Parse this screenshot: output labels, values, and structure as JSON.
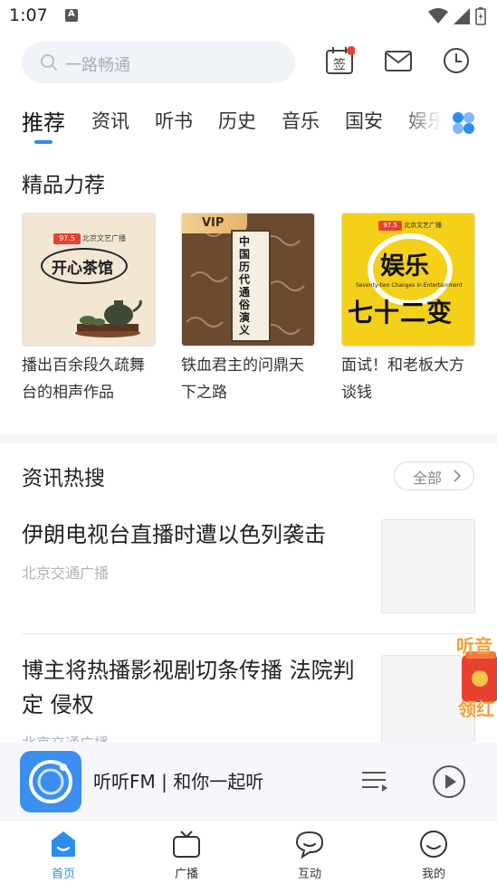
{
  "status_bar": {
    "time": "1:07"
  },
  "search": {
    "placeholder": "一路畅通"
  },
  "header_icons": [
    "sign-in-icon",
    "mail-icon",
    "history-clock-icon"
  ],
  "tabs": [
    {
      "label": "推荐",
      "active": true
    },
    {
      "label": "资讯"
    },
    {
      "label": "听书"
    },
    {
      "label": "历史"
    },
    {
      "label": "音乐"
    },
    {
      "label": "国安"
    },
    {
      "label": "娱乐"
    }
  ],
  "featured": {
    "title": "精品力荐",
    "items": [
      {
        "title": "播出百余段久疏舞台的相声作品",
        "cover_text": "开心茶馆",
        "cover_badge": "97.5",
        "cover_brand": "北京文艺广播"
      },
      {
        "title": "铁血君主的问鼎天下之路",
        "cover_text": "中国历代通俗演义",
        "cover_badge": "VIP"
      },
      {
        "title": "面试！和老板大方谈钱",
        "cover_text_1": "娱乐",
        "cover_text_2": "七十二变",
        "cover_subtitle": "Seventy-two Changes in Entertainment",
        "cover_badge": "97.5",
        "cover_brand": "北京文艺广播"
      }
    ]
  },
  "hot_news": {
    "title": "资讯热搜",
    "all_label": "全部",
    "items": [
      {
        "title": "伊朗电视台直播时遭以色列袭击",
        "source": "北京交通广播"
      },
      {
        "title": "博主将热播影视剧切条传播 法院判定 侵权",
        "source": "北京交通广播"
      }
    ]
  },
  "float_badge": {
    "text_1": "听音",
    "text_2": "领红"
  },
  "player": {
    "title": "听听FM | 和你一起听"
  },
  "bottom_nav": [
    {
      "label": "首页",
      "active": true
    },
    {
      "label": "广播"
    },
    {
      "label": "互动"
    },
    {
      "label": "我的"
    }
  ],
  "colors": {
    "accent": "#2d8cf0",
    "player_cover": "#3b8ff0",
    "badge_red": "#e8412f"
  }
}
